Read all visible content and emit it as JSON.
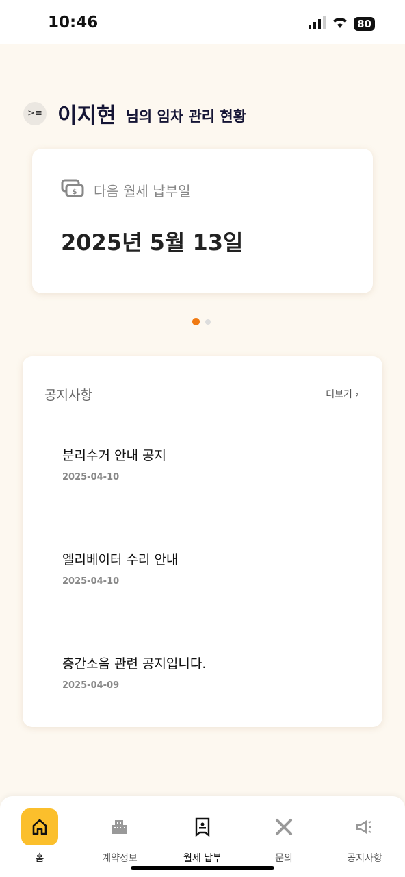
{
  "status": {
    "time": "10:46",
    "battery": "80"
  },
  "header": {
    "name": "이지현",
    "subtitle": "님의 임차 관리 현황"
  },
  "payment": {
    "label": "다음 월세 납부일",
    "date": "2025년 5월 13일"
  },
  "carousel": {
    "page": 1,
    "total": 2
  },
  "notices": {
    "title": "공지사항",
    "more": "더보기",
    "items": [
      {
        "title": "분리수거 안내 공지",
        "date": "2025-04-10"
      },
      {
        "title": "엘리베이터 수리 안내",
        "date": "2025-04-10"
      },
      {
        "title": "층간소음 관련 공지입니다.",
        "date": "2025-04-09"
      }
    ]
  },
  "nav": {
    "items": [
      {
        "label": "홈"
      },
      {
        "label": "계약정보"
      },
      {
        "label": "월세 납부"
      },
      {
        "label": "문의"
      },
      {
        "label": "공지사항"
      }
    ]
  },
  "colors": {
    "accent": "#f07a12",
    "active_tab": "#fbbf2c",
    "background": "#fdf8f0"
  }
}
